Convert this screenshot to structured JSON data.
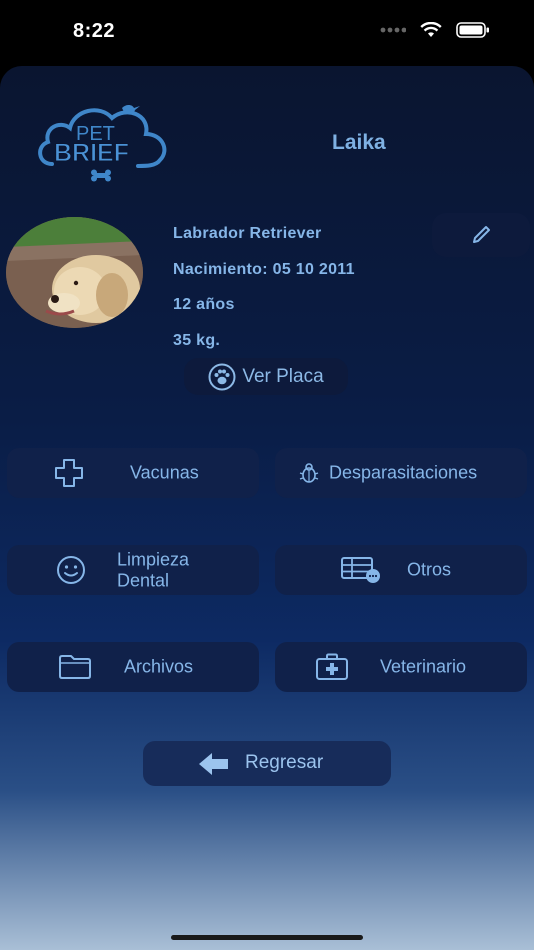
{
  "status_bar": {
    "time": "8:22"
  },
  "pet": {
    "name": "Laika",
    "breed": "Labrador Retriever",
    "birth": "Nacimiento: 05 10 2011",
    "age": "12 años",
    "weight": "35 kg."
  },
  "logo": {
    "line1": "PET",
    "line2": "BRIEF"
  },
  "actions": {
    "ver_placa": "Ver Placa",
    "vacunas": "Vacunas",
    "desparasitaciones": "Desparasitaciones",
    "limpieza_line1": "Limpieza",
    "limpieza_line2": "Dental",
    "otros": "Otros",
    "archivos": "Archivos",
    "veterinario": "Veterinario",
    "regresar": "Regresar"
  },
  "icons": {
    "edit": "pencil-icon",
    "placa": "paw-icon",
    "vacunas": "plus-icon",
    "desparasitaciones": "bug-icon",
    "limpieza": "smile-icon",
    "otros": "table-icon",
    "archivos": "folder-icon",
    "veterinario": "medkit-icon",
    "regresar": "arrow-left-icon"
  },
  "colors": {
    "accent": "#86b6e8",
    "tile_bg": "#10214a",
    "screen_top": "#0a1530"
  }
}
